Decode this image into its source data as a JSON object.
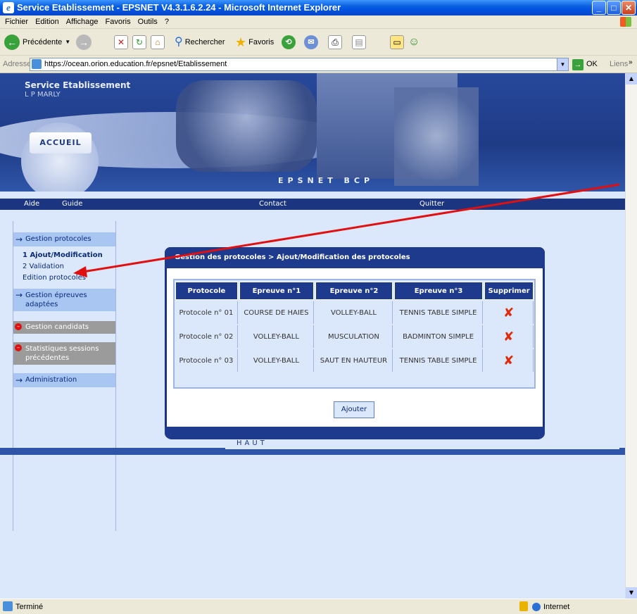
{
  "window": {
    "title": "Service Etablissement - EPSNET V4.3.1.6.2.24 - Microsoft Internet Explorer"
  },
  "menu": [
    "Fichier",
    "Edition",
    "Affichage",
    "Favoris",
    "Outils",
    "?"
  ],
  "toolbar": {
    "back": "Précédente",
    "search": "Rechercher",
    "favorites": "Favoris"
  },
  "address": {
    "label": "Adresse",
    "url": "https://ocean.orion.education.fr/epsnet/Etablissement",
    "go": "OK",
    "links": "Liens"
  },
  "banner": {
    "site_title": "Service Etablissement",
    "school": "L P MARLY",
    "home": "ACCUEIL",
    "product": "EPSNET BCP"
  },
  "nav": {
    "aide": "Aide",
    "guide": "Guide",
    "contact": "Contact",
    "quitter": "Quitter"
  },
  "sidebar": {
    "gestion_protocoles": "Gestion protocoles",
    "ajout": "1 Ajout/Modification",
    "validation": "2 Validation",
    "edition": "Edition protocoles",
    "gestion_epreuves": "Gestion épreuves adaptées",
    "gestion_candidats": "Gestion candidats",
    "statistiques": "Statistiques sessions précédentes",
    "administration": "Administration"
  },
  "panel": {
    "breadcrumb": "Gestion des protocoles > Ajout/Modification des protocoles",
    "add_button": "Ajouter"
  },
  "table": {
    "headers": [
      "Protocole",
      "Epreuve n°1",
      "Epreuve n°2",
      "Epreuve n°3",
      "Supprimer"
    ],
    "rows": [
      [
        "Protocole n° 01",
        "COURSE DE HAIES",
        "VOLLEY-BALL",
        "TENNIS TABLE SIMPLE"
      ],
      [
        "Protocole n° 02",
        "VOLLEY-BALL",
        "MUSCULATION",
        "BADMINTON SIMPLE"
      ],
      [
        "Protocole n° 03",
        "VOLLEY-BALL",
        "SAUT EN HAUTEUR",
        "TENNIS TABLE SIMPLE"
      ]
    ],
    "delete_glyph": "✘"
  },
  "footer": {
    "haut": "HAUT"
  },
  "status": {
    "left": "Terminé",
    "zone": "Internet"
  },
  "colors": {
    "titlebar": "#0054e3",
    "banner": "#1e3b86",
    "accent_arrow": "#e01010"
  }
}
